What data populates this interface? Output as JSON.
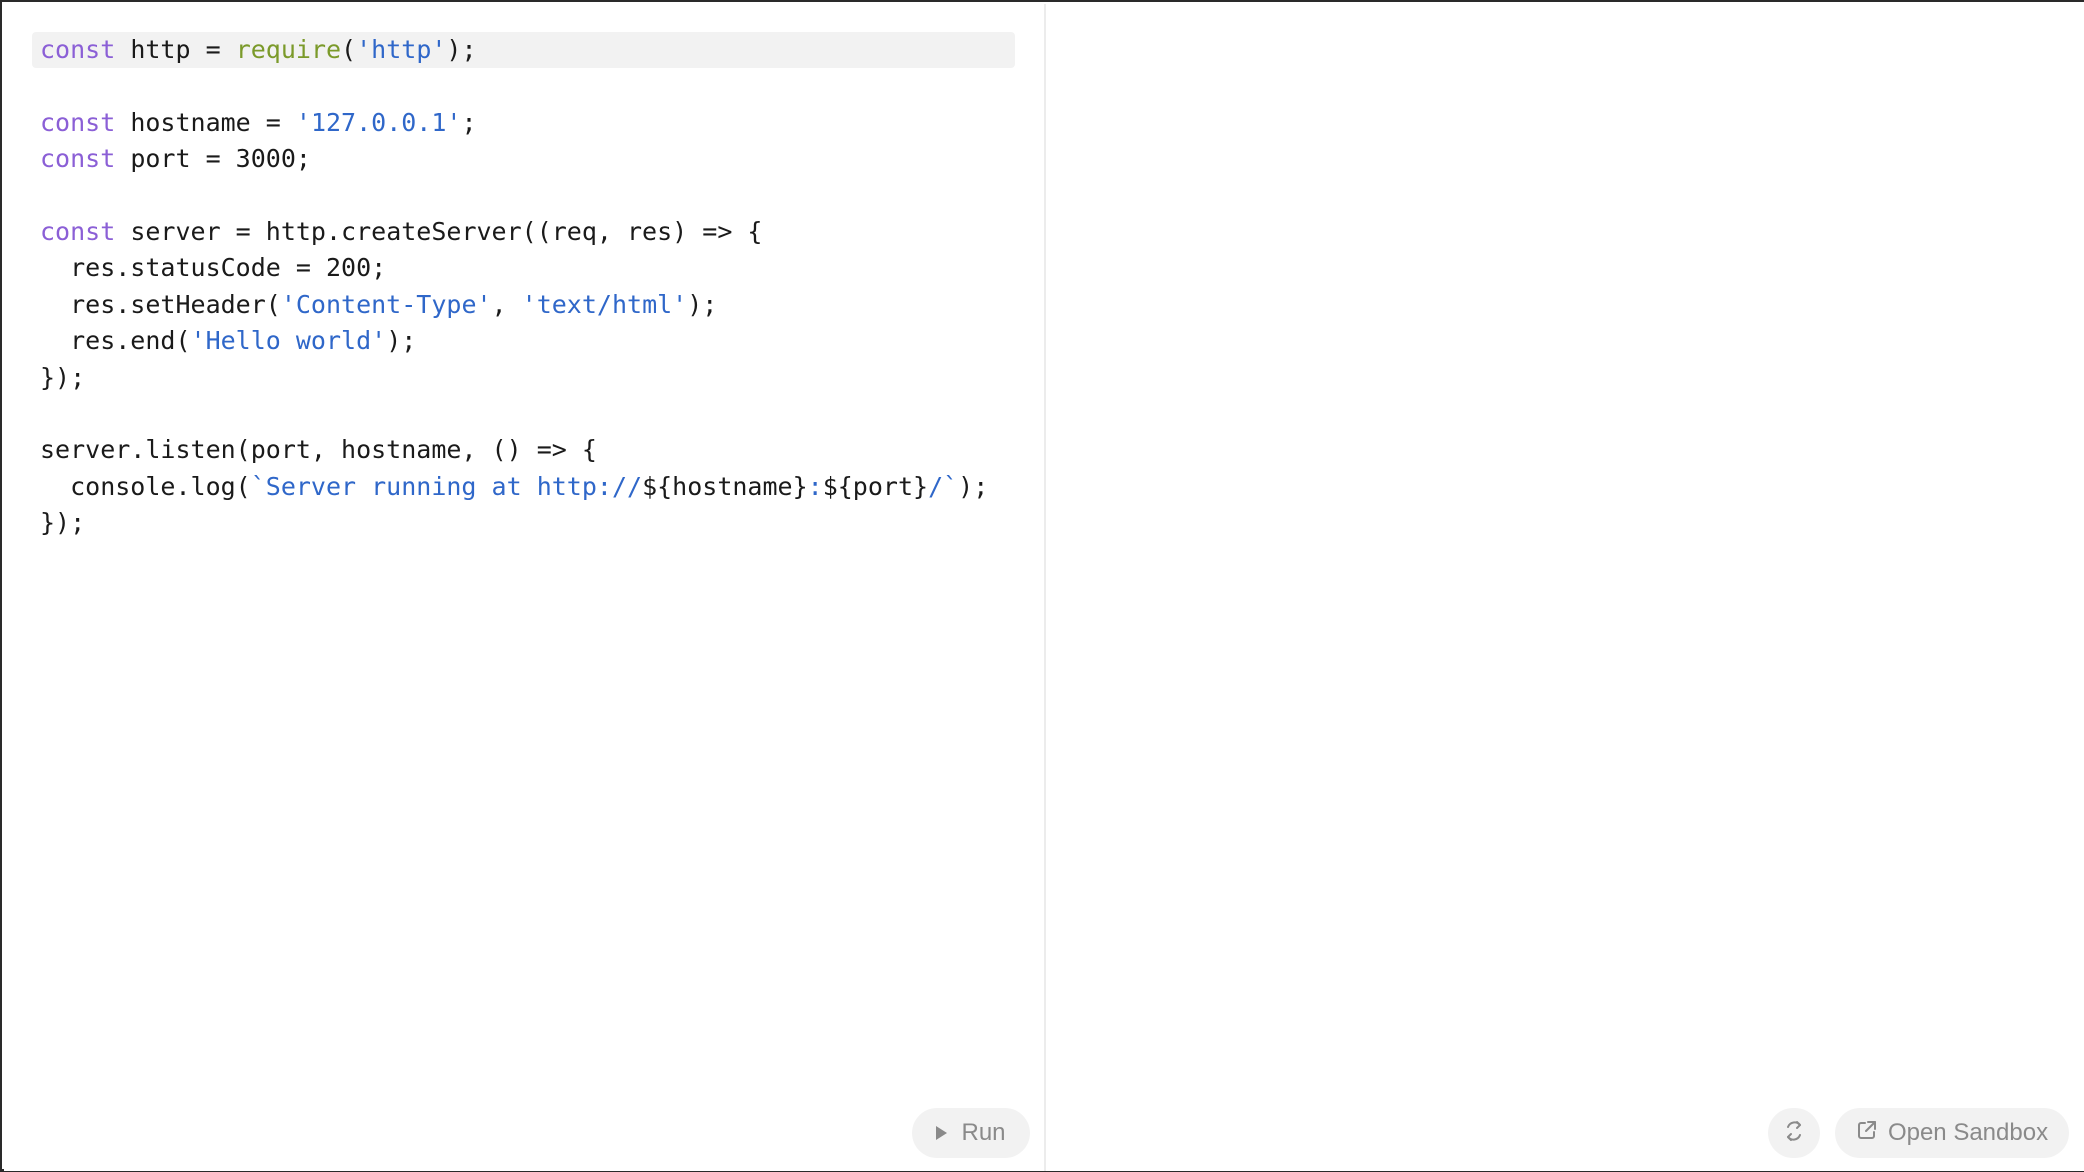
{
  "editor": {
    "language": "javascript",
    "lines": [
      [
        {
          "t": "kw",
          "v": "const"
        },
        {
          "t": "plain",
          "v": " http = "
        },
        {
          "t": "fn",
          "v": "require"
        },
        {
          "t": "plain",
          "v": "("
        },
        {
          "t": "str",
          "v": "'http'"
        },
        {
          "t": "plain",
          "v": ");"
        }
      ],
      [],
      [
        {
          "t": "kw",
          "v": "const"
        },
        {
          "t": "plain",
          "v": " hostname = "
        },
        {
          "t": "str",
          "v": "'127.0.0.1'"
        },
        {
          "t": "plain",
          "v": ";"
        }
      ],
      [
        {
          "t": "kw",
          "v": "const"
        },
        {
          "t": "plain",
          "v": " port = 3000;"
        }
      ],
      [],
      [
        {
          "t": "kw",
          "v": "const"
        },
        {
          "t": "plain",
          "v": " server = http.createServer((req, res) => {"
        }
      ],
      [
        {
          "t": "plain",
          "v": "  res.statusCode = 200;"
        }
      ],
      [
        {
          "t": "plain",
          "v": "  res.setHeader("
        },
        {
          "t": "str",
          "v": "'Content-Type'"
        },
        {
          "t": "plain",
          "v": ", "
        },
        {
          "t": "str",
          "v": "'text/html'"
        },
        {
          "t": "plain",
          "v": ");"
        }
      ],
      [
        {
          "t": "plain",
          "v": "  res.end("
        },
        {
          "t": "str",
          "v": "'Hello world'"
        },
        {
          "t": "plain",
          "v": ");"
        }
      ],
      [
        {
          "t": "plain",
          "v": "});"
        }
      ],
      [],
      [
        {
          "t": "plain",
          "v": "server.listen(port, hostname, () => {"
        }
      ],
      [
        {
          "t": "plain",
          "v": "  console.log("
        },
        {
          "t": "str",
          "v": "`Server running at http://"
        },
        {
          "t": "plain",
          "v": "${hostname}"
        },
        {
          "t": "str",
          "v": ":"
        },
        {
          "t": "plain",
          "v": "${port}"
        },
        {
          "t": "str",
          "v": "/`"
        },
        {
          "t": "plain",
          "v": ");"
        }
      ],
      [
        {
          "t": "plain",
          "v": "});"
        }
      ]
    ],
    "active_line": 1
  },
  "toolbar": {
    "run_label": "Run",
    "run_icon": "play-icon",
    "refresh_icon": "refresh-icon",
    "open_sandbox_label": "Open Sandbox",
    "open_sandbox_icon": "external-link-icon"
  },
  "colors": {
    "keyword": "#8b5fd6",
    "function": "#7b9a2a",
    "string": "#2f67c9",
    "text": "#1a1a1a",
    "button_bg": "#f2f2f2",
    "button_text": "#8a8a8a"
  }
}
